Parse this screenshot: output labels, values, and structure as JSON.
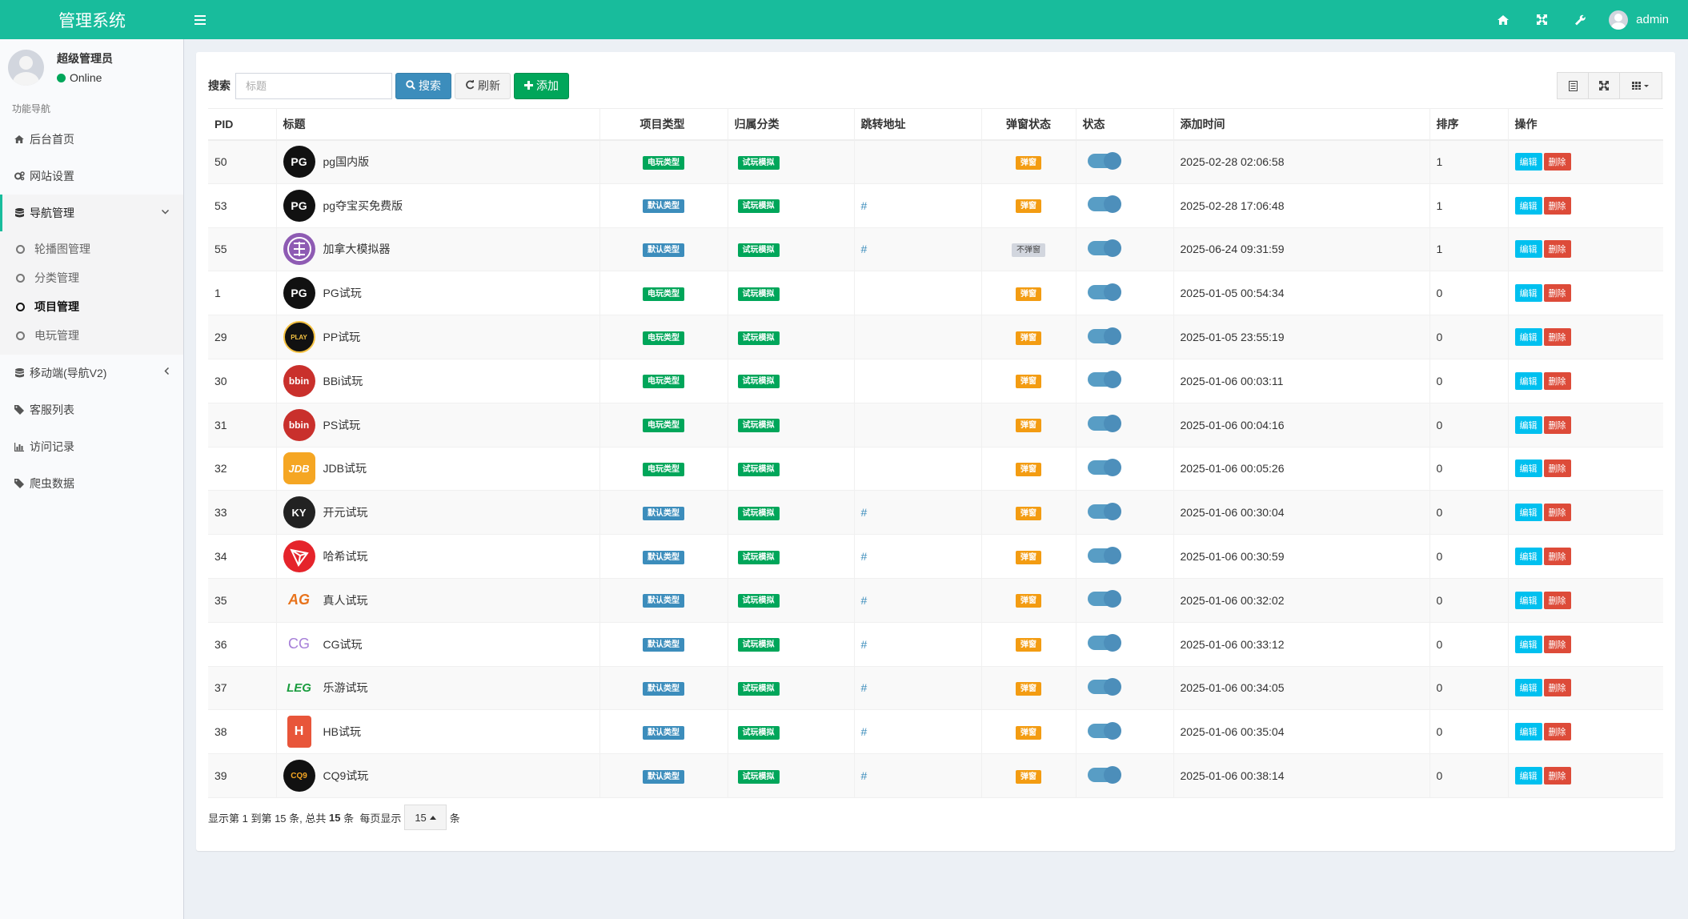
{
  "app": {
    "brand": "管理系统",
    "menu_icon": "hamburger-icon",
    "header_icons": [
      "home-icon",
      "fullscreen-icon",
      "wrench-icon"
    ],
    "username": "admin",
    "accent_color": "#18bc9c"
  },
  "sidebar": {
    "user_name": "超级管理员",
    "user_status": "Online",
    "nav_header": "功能导航",
    "items": [
      {
        "label": "后台首页",
        "icon": "home-icon"
      },
      {
        "label": "网站设置",
        "icon": "cogs-icon"
      },
      {
        "label": "导航管理",
        "icon": "database-icon"
      },
      {
        "label": "移动端(导航V2)",
        "icon": "database-icon"
      },
      {
        "label": "客服列表",
        "icon": "tag-icon"
      },
      {
        "label": "访问记录",
        "icon": "bar-chart-icon"
      },
      {
        "label": "爬虫数据",
        "icon": "tag-icon"
      }
    ],
    "submenu": [
      "轮播图管理",
      "分类管理",
      "项目管理",
      "电玩管理"
    ]
  },
  "toolbar": {
    "search_label": "搜索",
    "search_placeholder": "标题",
    "search_button": "搜索",
    "refresh_button": "刷新",
    "add_button": "添加",
    "right_icons": [
      "list-icon",
      "fullscreen-icon",
      "columns-icon"
    ]
  },
  "table": {
    "headers": [
      "PID",
      "标题",
      "项目类型",
      "归属分类",
      "跳转地址",
      "弹窗状态",
      "状态",
      "添加时间",
      "排序",
      "操作"
    ],
    "edit_label": "编辑",
    "delete_label": "删除",
    "rows": [
      {
        "pid": "50",
        "title": "pg国内版",
        "logo": "PG",
        "type": "电玩类型",
        "category": "试玩模拟",
        "url": "",
        "popup": "弹窗",
        "time": "2025-02-28 02:06:58",
        "sort": "1"
      },
      {
        "pid": "53",
        "title": "pg夺宝买免费版",
        "logo": "PG",
        "type": "默认类型",
        "category": "试玩模拟",
        "url": "#",
        "popup": "弹窗",
        "time": "2025-02-28 17:06:48",
        "sort": "1"
      },
      {
        "pid": "55",
        "title": "加拿大模拟器",
        "logo": "",
        "type": "默认类型",
        "category": "试玩模拟",
        "url": "#",
        "popup": "不弹窗",
        "time": "2025-06-24 09:31:59",
        "sort": "1"
      },
      {
        "pid": "1",
        "title": "PG试玩",
        "logo": "PG",
        "type": "电玩类型",
        "category": "试玩模拟",
        "url": "",
        "popup": "弹窗",
        "time": "2025-01-05 00:54:34",
        "sort": "0"
      },
      {
        "pid": "29",
        "title": "PP试玩",
        "logo": "PLAY",
        "type": "电玩类型",
        "category": "试玩模拟",
        "url": "",
        "popup": "弹窗",
        "time": "2025-01-05 23:55:19",
        "sort": "0"
      },
      {
        "pid": "30",
        "title": "BBi试玩",
        "logo": "bbin",
        "type": "电玩类型",
        "category": "试玩模拟",
        "url": "",
        "popup": "弹窗",
        "time": "2025-01-06 00:03:11",
        "sort": "0"
      },
      {
        "pid": "31",
        "title": "PS试玩",
        "logo": "bbin",
        "type": "电玩类型",
        "category": "试玩模拟",
        "url": "",
        "popup": "弹窗",
        "time": "2025-01-06 00:04:16",
        "sort": "0"
      },
      {
        "pid": "32",
        "title": "JDB试玩",
        "logo": "JDB",
        "type": "电玩类型",
        "category": "试玩模拟",
        "url": "",
        "popup": "弹窗",
        "time": "2025-01-06 00:05:26",
        "sort": "0"
      },
      {
        "pid": "33",
        "title": "开元试玩",
        "logo": "KY",
        "type": "默认类型",
        "category": "试玩模拟",
        "url": "#",
        "popup": "弹窗",
        "time": "2025-01-06 00:30:04",
        "sort": "0"
      },
      {
        "pid": "34",
        "title": "哈希试玩",
        "logo": "",
        "type": "默认类型",
        "category": "试玩模拟",
        "url": "#",
        "popup": "弹窗",
        "time": "2025-01-06 00:30:59",
        "sort": "0"
      },
      {
        "pid": "35",
        "title": "真人试玩",
        "logo": "AG",
        "type": "默认类型",
        "category": "试玩模拟",
        "url": "#",
        "popup": "弹窗",
        "time": "2025-01-06 00:32:02",
        "sort": "0"
      },
      {
        "pid": "36",
        "title": "CG试玩",
        "logo": "CG",
        "type": "默认类型",
        "category": "试玩模拟",
        "url": "#",
        "popup": "弹窗",
        "time": "2025-01-06 00:33:12",
        "sort": "0"
      },
      {
        "pid": "37",
        "title": "乐游试玩",
        "logo": "LEG",
        "type": "默认类型",
        "category": "试玩模拟",
        "url": "#",
        "popup": "弹窗",
        "time": "2025-01-06 00:34:05",
        "sort": "0"
      },
      {
        "pid": "38",
        "title": "HB试玩",
        "logo": "H",
        "type": "默认类型",
        "category": "试玩模拟",
        "url": "#",
        "popup": "弹窗",
        "time": "2025-01-06 00:35:04",
        "sort": "0"
      },
      {
        "pid": "39",
        "title": "CQ9试玩",
        "logo": "CQ9",
        "type": "默认类型",
        "category": "试玩模拟",
        "url": "#",
        "popup": "弹窗",
        "time": "2025-01-06 00:38:14",
        "sort": "0"
      }
    ]
  },
  "pager": {
    "text_prefix": "显示第 1 到第 15 条, 总共",
    "total": "15",
    "text_mid": "条  每页显示",
    "page_size": "15",
    "text_suffix": "条"
  },
  "colors": {
    "type_game": "#00a65a",
    "type_default": "#3c8dbc",
    "popup_on": "#f39c12",
    "popup_off": "#d2d6de"
  }
}
